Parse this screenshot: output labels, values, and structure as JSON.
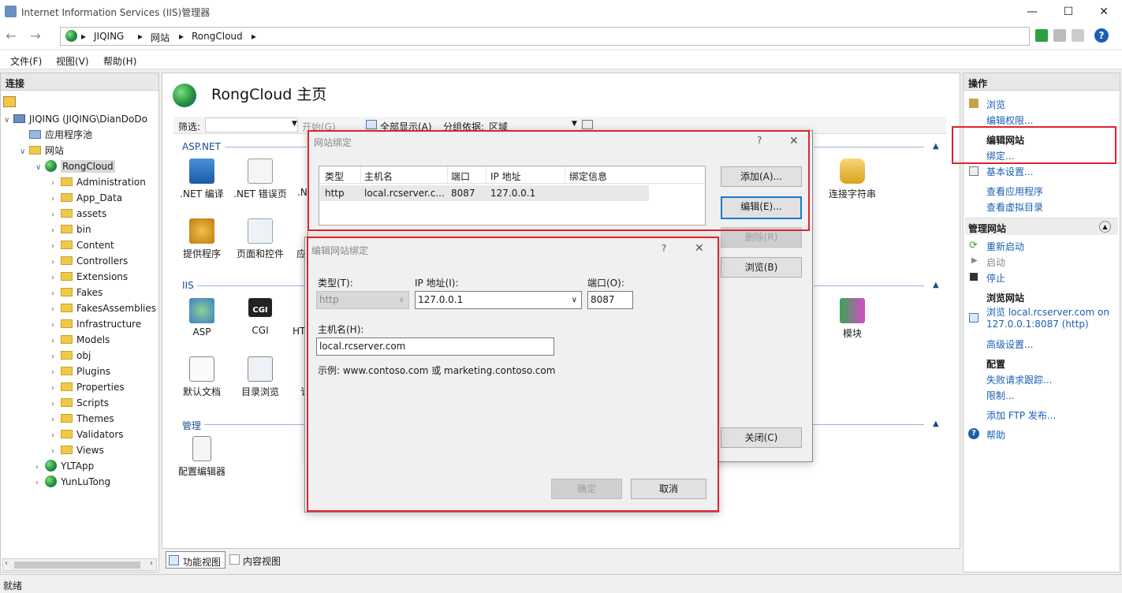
{
  "window": {
    "title": "Internet Information Services (IIS)管理器",
    "min": "—",
    "max": "☐",
    "close": "✕"
  },
  "nav": {
    "back": "←",
    "forward": "→",
    "crumbs": [
      "JIQING",
      "网站",
      "RongCloud"
    ],
    "sep": "▸"
  },
  "menu": [
    "文件(F)",
    "视图(V)",
    "帮助(H)"
  ],
  "connections": {
    "title": "连接",
    "tree": [
      {
        "label": "JIQING (JIQING\\DianDoDo",
        "kind": "server"
      },
      {
        "label": "应用程序池",
        "kind": "pool"
      },
      {
        "label": "网站",
        "kind": "sites"
      },
      {
        "label": "RongCloud",
        "kind": "site"
      },
      {
        "label": "Administration",
        "kind": "folder"
      },
      {
        "label": "App_Data",
        "kind": "folder"
      },
      {
        "label": "assets",
        "kind": "folder"
      },
      {
        "label": "bin",
        "kind": "folder"
      },
      {
        "label": "Content",
        "kind": "folder"
      },
      {
        "label": "Controllers",
        "kind": "folder"
      },
      {
        "label": "Extensions",
        "kind": "folder"
      },
      {
        "label": "Fakes",
        "kind": "folder"
      },
      {
        "label": "FakesAssemblies",
        "kind": "folder"
      },
      {
        "label": "Infrastructure",
        "kind": "folder"
      },
      {
        "label": "Models",
        "kind": "folder"
      },
      {
        "label": "obj",
        "kind": "folder"
      },
      {
        "label": "Plugins",
        "kind": "folder"
      },
      {
        "label": "Properties",
        "kind": "folder"
      },
      {
        "label": "Scripts",
        "kind": "folder"
      },
      {
        "label": "Themes",
        "kind": "folder"
      },
      {
        "label": "Validators",
        "kind": "folder"
      },
      {
        "label": "Views",
        "kind": "folder"
      },
      {
        "label": "YLTApp",
        "kind": "site2"
      },
      {
        "label": "YunLuTong",
        "kind": "site2"
      }
    ]
  },
  "main": {
    "title": "RongCloud 主页",
    "filter": {
      "label": "筛选:",
      "start": "开始(G)",
      "showall": "全部显示(A)",
      "group": "分组依据:",
      "group_value": "区域"
    },
    "sections": {
      "aspnet": "ASP.NET",
      "iis": "IIS",
      "manage": "管理"
    },
    "features": {
      "net_compile": ".NET 编译",
      "net_error": ".NET 错误页",
      "net_partial": ".N",
      "providers": "提供程序",
      "pages": "页面和控件",
      "app_partial": "应",
      "conn_strings": "连接字符串",
      "asp": "ASP",
      "cgi": "CGI",
      "ht_partial": "HT",
      "modules": "模块",
      "default_doc": "默认文档",
      "dir_browse": "目录浏览",
      "s_partial": "讠",
      "config_editor": "配置编辑器"
    },
    "cgi_icon": "CGI",
    "view_tabs": [
      "功能视图",
      "内容视图"
    ]
  },
  "binding_dialog": {
    "title": "网站绑定",
    "help": "?",
    "close": "✕",
    "columns": [
      "类型",
      "主机名",
      "端口",
      "IP 地址",
      "绑定信息"
    ],
    "rows": [
      [
        "http",
        "local.rcserver.c...",
        "8087",
        "127.0.0.1",
        ""
      ]
    ],
    "buttons": {
      "add": "添加(A)...",
      "edit": "编辑(E)...",
      "remove": "删除(R)",
      "browse": "浏览(B)",
      "close": "关闭(C)"
    }
  },
  "edit_dialog": {
    "title": "编辑网站绑定",
    "help": "?",
    "close": "✕",
    "type_label": "类型(T):",
    "type_value": "http",
    "ip_label": "IP 地址(I):",
    "ip_value": "127.0.0.1",
    "port_label": "端口(O):",
    "port_value": "8087",
    "host_label": "主机名(H):",
    "host_value": "local.rcserver.com",
    "example": "示例: www.contoso.com 或 marketing.contoso.com",
    "ok": "确定",
    "cancel": "取消"
  },
  "actions": {
    "title": "操作",
    "browse": "浏览",
    "edit_perm": "编辑权限...",
    "edit_site": "编辑网站",
    "bindings": "绑定...",
    "basic": "基本设置...",
    "view_apps": "查看应用程序",
    "view_vdirs": "查看虚拟目录",
    "manage_site": "管理网站",
    "restart": "重新启动",
    "start": "启动",
    "stop": "停止",
    "browse_site": "浏览网站",
    "browse_link1": "浏览 local.rcserver.com on",
    "browse_link2": "127.0.0.1:8087 (http)",
    "advanced": "高级设置...",
    "config": "配置",
    "failed_req": "失败请求跟踪...",
    "limits": "限制...",
    "add_ftp": "添加 FTP 发布...",
    "help": "帮助"
  },
  "status": "就绪",
  "colors": {
    "accent": "#1a5fb4",
    "highlight": "#e0242a"
  }
}
